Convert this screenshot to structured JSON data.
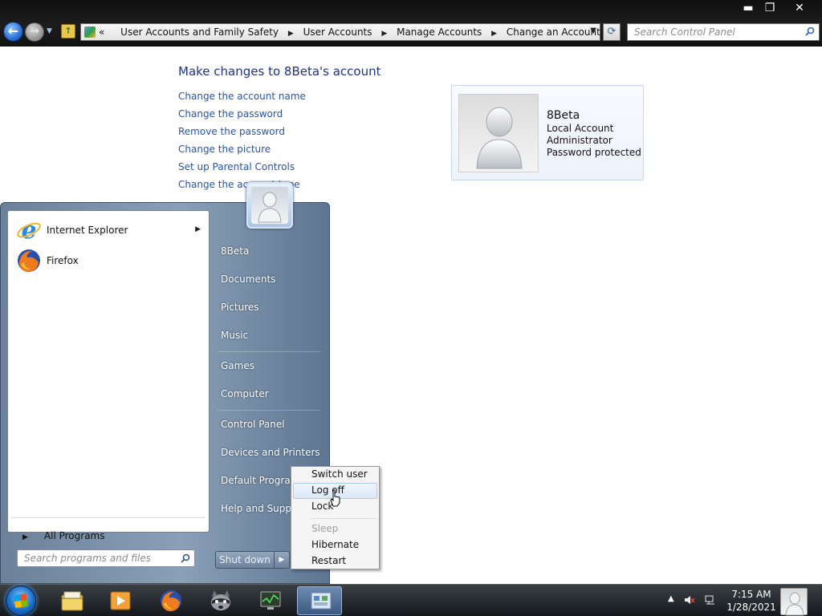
{
  "window": {
    "min_label": "▬",
    "max_label": "❐",
    "close_label": "✕"
  },
  "address": {
    "overflow": "«",
    "crumbs": [
      "User Accounts and Family Safety",
      "User Accounts",
      "Manage Accounts",
      "Change an Account"
    ]
  },
  "search": {
    "placeholder": "Search Control Panel"
  },
  "control_panel": {
    "title": "Make changes to 8Beta's account",
    "links": [
      "Change the account name",
      "Change the password",
      "Remove the password",
      "Change the picture",
      "Set up Parental Controls",
      "Change the account type"
    ]
  },
  "account": {
    "name": "8Beta",
    "type": "Local Account",
    "role": "Administrator",
    "status": "Password protected"
  },
  "start_menu": {
    "programs": [
      {
        "label": "Internet Explorer",
        "icon": "internet-explorer-icon",
        "has_submenu": true
      },
      {
        "label": "Firefox",
        "icon": "firefox-icon",
        "has_submenu": false
      }
    ],
    "all_programs": "All Programs",
    "search_placeholder": "Search programs and files",
    "right_items": [
      "8Beta",
      "Documents",
      "Pictures",
      "Music",
      "Games",
      "Computer",
      "Control Panel",
      "Devices and Printers",
      "Default Programs",
      "Help and Support"
    ],
    "shutdown_label": "Shut down"
  },
  "power_menu": {
    "items": [
      {
        "label": "Switch user",
        "state": "normal"
      },
      {
        "label": "Log off",
        "state": "hover"
      },
      {
        "label": "Lock",
        "state": "normal"
      },
      {
        "label": "Sleep",
        "state": "disabled"
      },
      {
        "label": "Hibernate",
        "state": "normal"
      },
      {
        "label": "Restart",
        "state": "normal"
      }
    ]
  },
  "taskbar": {
    "pinned": [
      "windows-explorer-icon",
      "media-player-icon",
      "firefox-icon",
      "raccoon-app-icon",
      "system-monitor-icon",
      "control-panel-icon"
    ],
    "time": "7:15 AM",
    "date": "1/28/2021"
  },
  "colors": {
    "link": "#2455b0",
    "title": "#1e3287",
    "start_menu": "#8aa0b8",
    "taskbar": "#15191c"
  }
}
